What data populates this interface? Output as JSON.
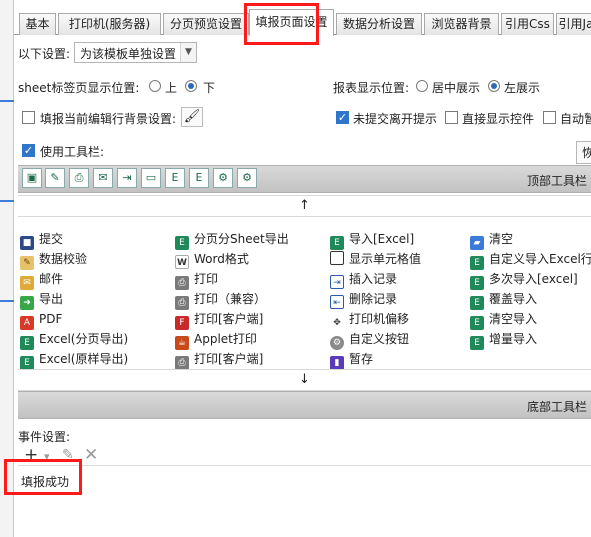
{
  "tabs": [
    {
      "label": "基本"
    },
    {
      "label": "打印机(服务器)"
    },
    {
      "label": "分页预览设置"
    },
    {
      "label": "填报页面设置"
    },
    {
      "label": "数据分析设置"
    },
    {
      "label": "浏览器背景"
    },
    {
      "label": "引用Css"
    },
    {
      "label": "引用Ja"
    }
  ],
  "active_tab": "填报页面设置",
  "settings": {
    "template_label": "以下设置:",
    "template_select_value": "为该模板单独设置",
    "sheet_pos_label": "sheet标签页显示位置:",
    "sheet_pos_top": "上",
    "sheet_pos_bottom": "下",
    "sheet_pos_selected": "下",
    "report_pos_label": "报表显示位置:",
    "report_pos_center": "居中展示",
    "report_pos_left": "左展示",
    "report_pos_selected": "左展示",
    "row_bg_label": "填报当前编辑行背景设置:",
    "unsubmitted_label": "未提交离开提示",
    "direct_widget_label": "直接显示控件",
    "auto_label": "自动暂",
    "use_toolbar_label": "使用工具栏:",
    "right_cut_label": "恢"
  },
  "top_toolbar": {
    "label": "顶部工具栏"
  },
  "bottom_toolbar": {
    "label": "底部工具栏"
  },
  "arrows": {
    "up": "↑",
    "down": "↓"
  },
  "buttons": [
    {
      "label": "提交",
      "icon": "save-icon"
    },
    {
      "label": "分页分Sheet导出",
      "icon": "excel-icon"
    },
    {
      "label": "导入[Excel]",
      "icon": "excel-icon"
    },
    {
      "label": "清空",
      "icon": "eraser-icon"
    },
    {
      "label": "数据校验",
      "icon": "check-pencil-icon"
    },
    {
      "label": "Word格式",
      "icon": "word-icon"
    },
    {
      "label": "显示单元格值",
      "icon": "cell-grid-icon"
    },
    {
      "label": "自定义导入Excel行",
      "icon": "excel-icon"
    },
    {
      "label": "邮件",
      "icon": "mail-icon"
    },
    {
      "label": "打印",
      "icon": "printer-icon"
    },
    {
      "label": "插入记录",
      "icon": "insert-row-icon"
    },
    {
      "label": "多次导入[excel]",
      "icon": "excel-icon"
    },
    {
      "label": "导出",
      "icon": "export-icon"
    },
    {
      "label": "打印（兼容）",
      "icon": "printer-icon"
    },
    {
      "label": "删除记录",
      "icon": "delete-row-icon"
    },
    {
      "label": "覆盖导入",
      "icon": "excel-icon"
    },
    {
      "label": "PDF",
      "icon": "pdf-icon"
    },
    {
      "label": "打印[客户端]",
      "icon": "flash-print-icon"
    },
    {
      "label": "打印机偏移",
      "icon": "move-icon"
    },
    {
      "label": "清空导入",
      "icon": "excel-icon"
    },
    {
      "label": "Excel(分页导出)",
      "icon": "excel-icon"
    },
    {
      "label": "Applet打印",
      "icon": "applet-icon"
    },
    {
      "label": "自定义按钮",
      "icon": "gear-icon"
    },
    {
      "label": "增量导入",
      "icon": "excel-icon"
    },
    {
      "label": "Excel(原样导出)",
      "icon": "excel-icon"
    },
    {
      "label": "打印[客户端]",
      "icon": "printer-icon"
    },
    {
      "label": "暂存",
      "icon": "pause-icon"
    }
  ],
  "events": {
    "label": "事件设置:",
    "items": [
      "填报成功"
    ]
  },
  "colors": {
    "highlight": "#ff1a1a",
    "toolbar_gray": "#c8c8c8",
    "accent": "#2f76c8"
  }
}
